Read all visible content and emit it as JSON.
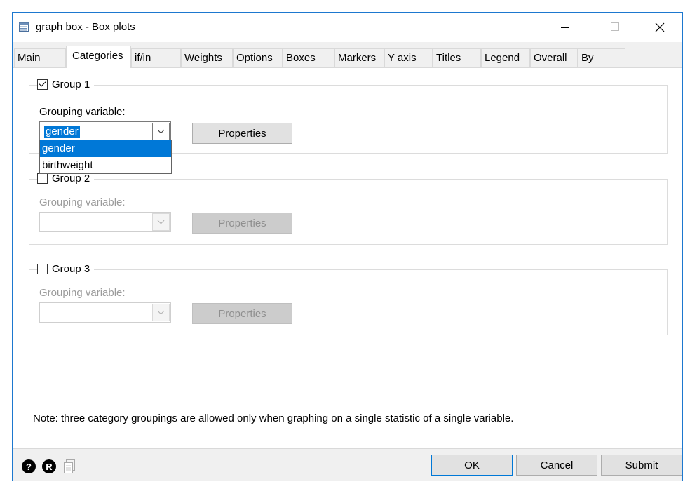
{
  "window": {
    "title": "graph box - Box plots",
    "controls": {
      "minimize": "minimize-icon",
      "maximize": "maximize-icon",
      "close": "close-icon"
    }
  },
  "tabs": [
    {
      "label": "Main"
    },
    {
      "label": "Categories",
      "active": true
    },
    {
      "label": "if/in"
    },
    {
      "label": "Weights"
    },
    {
      "label": "Options"
    },
    {
      "label": "Boxes"
    },
    {
      "label": "Markers"
    },
    {
      "label": "Y axis"
    },
    {
      "label": "Titles"
    },
    {
      "label": "Legend"
    },
    {
      "label": "Overall"
    },
    {
      "label": "By"
    }
  ],
  "groups": [
    {
      "label": "Group 1",
      "checked": true,
      "field_label": "Grouping variable:",
      "value": "gender",
      "properties_label": "Properties",
      "dropdown_open": true,
      "options": [
        "gender",
        "birthweight"
      ]
    },
    {
      "label": "Group 2",
      "checked": false,
      "field_label": "Grouping variable:",
      "value": "",
      "properties_label": "Properties"
    },
    {
      "label": "Group 3",
      "checked": false,
      "field_label": "Grouping variable:",
      "value": "",
      "properties_label": "Properties"
    }
  ],
  "note": "Note: three category groupings are allowed only when graphing on a single statistic of a single variable.",
  "footer": {
    "help_icon_label": "?",
    "reset_icon_label": "R",
    "ok_label": "OK",
    "cancel_label": "Cancel",
    "submit_label": "Submit"
  },
  "colors": {
    "accent": "#0078d7",
    "window_border": "#1d78cf",
    "dialog_bg": "#f0f0f0"
  }
}
